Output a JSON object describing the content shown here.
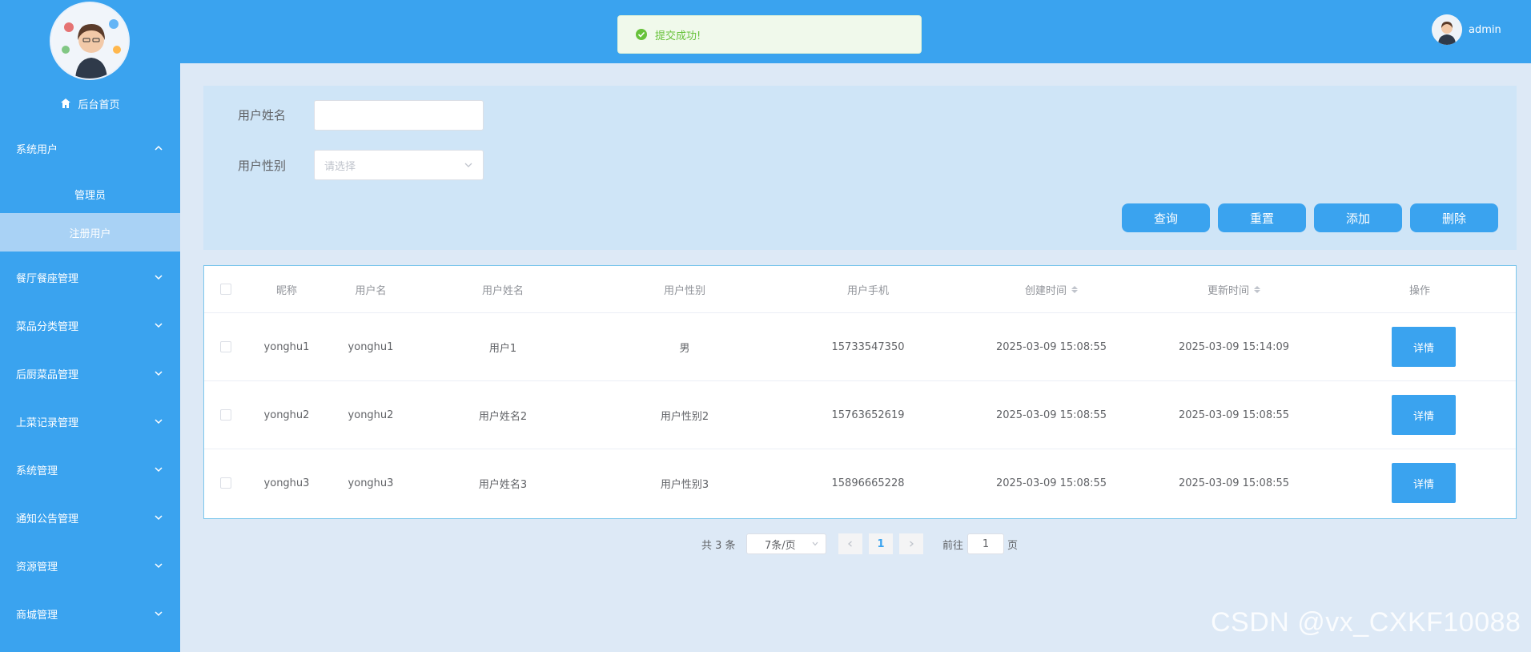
{
  "sidebar": {
    "home_label": "后台首页",
    "groups": [
      {
        "label": "系统用户",
        "expanded": true,
        "items": [
          {
            "label": "管理员",
            "active": false
          },
          {
            "label": "注册用户",
            "active": true
          }
        ]
      },
      {
        "label": "餐厅餐座管理"
      },
      {
        "label": "菜品分类管理"
      },
      {
        "label": "后厨菜品管理"
      },
      {
        "label": "上菜记录管理"
      },
      {
        "label": "系统管理"
      },
      {
        "label": "通知公告管理"
      },
      {
        "label": "资源管理"
      },
      {
        "label": "商城管理"
      }
    ]
  },
  "header": {
    "toast_text": "提交成功!",
    "username": "admin"
  },
  "filter": {
    "name_label": "用户姓名",
    "name_value": "",
    "gender_label": "用户性别",
    "gender_placeholder": "请选择"
  },
  "buttons": {
    "query": "查询",
    "reset": "重置",
    "add": "添加",
    "delete": "删除"
  },
  "table": {
    "columns": [
      "昵称",
      "用户名",
      "用户姓名",
      "用户性别",
      "用户手机",
      "创建时间",
      "更新时间",
      "操作"
    ],
    "rows": [
      {
        "nickname": "yonghu1",
        "username": "yonghu1",
        "real_name": "用户1",
        "gender": "男",
        "phone": "15733547350",
        "created": "2025-03-09 15:08:55",
        "updated": "2025-03-09 15:14:09",
        "action": "详情"
      },
      {
        "nickname": "yonghu2",
        "username": "yonghu2",
        "real_name": "用户姓名2",
        "gender": "用户性别2",
        "phone": "15763652619",
        "created": "2025-03-09 15:08:55",
        "updated": "2025-03-09 15:08:55",
        "action": "详情"
      },
      {
        "nickname": "yonghu3",
        "username": "yonghu3",
        "real_name": "用户姓名3",
        "gender": "用户性别3",
        "phone": "15896665228",
        "created": "2025-03-09 15:08:55",
        "updated": "2025-03-09 15:08:55",
        "action": "详情"
      }
    ]
  },
  "pagination": {
    "total_text": "共 3 条",
    "page_size": "7条/页",
    "current_page": "1",
    "goto_prefix": "前往",
    "goto_value": "1",
    "goto_suffix": "页"
  },
  "watermark": "CSDN @vx_CXKF10088",
  "colors": {
    "primary": "#3aa3ef",
    "success": "#67c23a"
  }
}
